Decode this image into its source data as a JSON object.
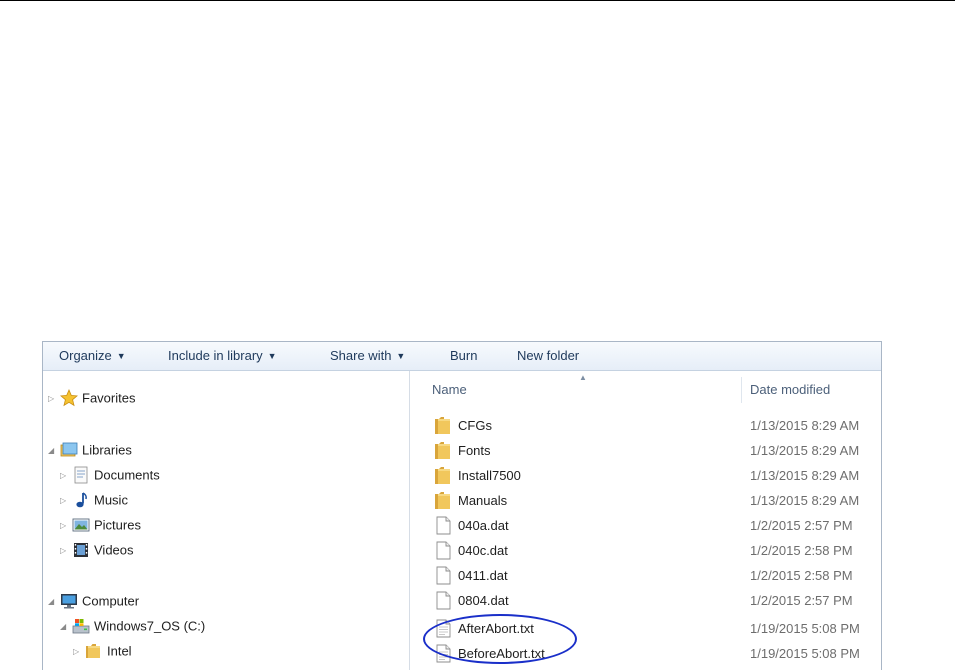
{
  "toolbar": {
    "organize": "Organize",
    "include_in_library": "Include in library",
    "share_with": "Share with",
    "burn": "Burn",
    "new_folder": "New folder"
  },
  "nav": {
    "favorites": "Favorites",
    "libraries": "Libraries",
    "documents": "Documents",
    "music": "Music",
    "pictures": "Pictures",
    "videos": "Videos",
    "computer": "Computer",
    "drive_c": "Windows7_OS (C:)",
    "intel": "Intel"
  },
  "columns": {
    "name": "Name",
    "date_modified": "Date modified"
  },
  "files": [
    {
      "name": "CFGs",
      "date": "1/13/2015 8:29 AM",
      "type": "folder"
    },
    {
      "name": "Fonts",
      "date": "1/13/2015 8:29 AM",
      "type": "folder"
    },
    {
      "name": "Install7500",
      "date": "1/13/2015 8:29 AM",
      "type": "folder"
    },
    {
      "name": "Manuals",
      "date": "1/13/2015 8:29 AM",
      "type": "folder"
    },
    {
      "name": "040a.dat",
      "date": "1/2/2015 2:57 PM",
      "type": "file"
    },
    {
      "name": "040c.dat",
      "date": "1/2/2015 2:58 PM",
      "type": "file"
    },
    {
      "name": "0411.dat",
      "date": "1/2/2015 2:58 PM",
      "type": "file"
    },
    {
      "name": "0804.dat",
      "date": "1/2/2015 2:57 PM",
      "type": "file"
    },
    {
      "name": "AfterAbort.txt",
      "date": "1/19/2015 5:08 PM",
      "type": "text"
    },
    {
      "name": "BeforeAbort.txt",
      "date": "1/19/2015 5:08 PM",
      "type": "text"
    }
  ],
  "colors": {
    "highlight": "#1a2fc9",
    "toolbar_text": "#1e395b",
    "folder": "#e8b94a"
  }
}
